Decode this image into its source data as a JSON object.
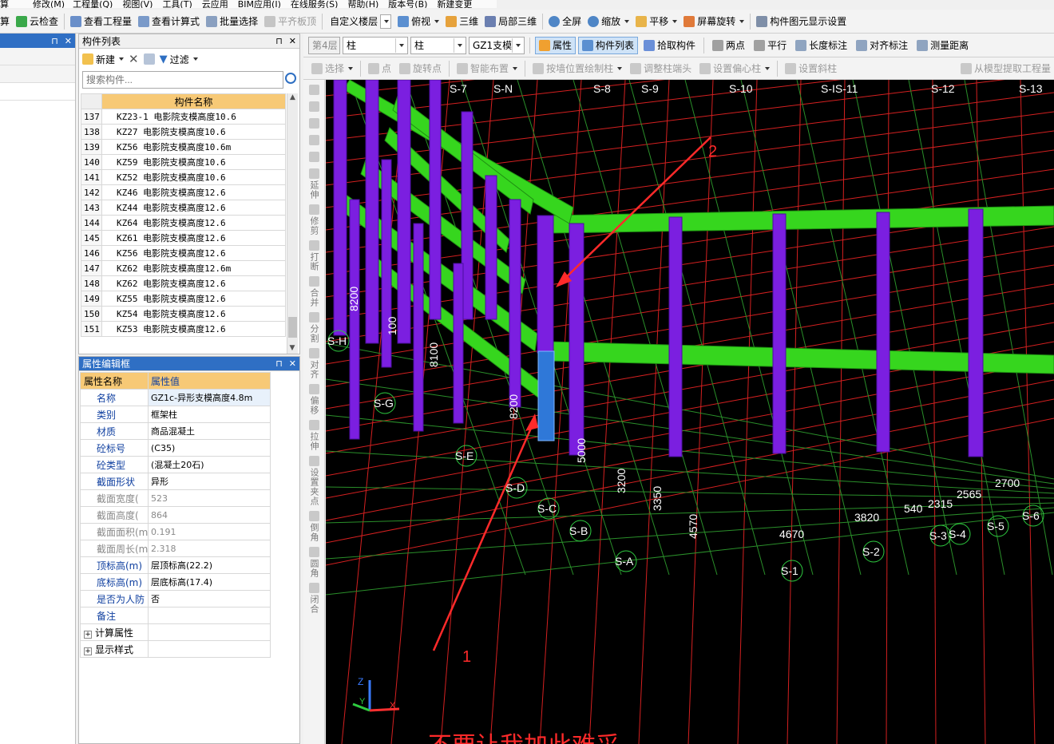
{
  "menu": {
    "items": [
      "算",
      "修改(M)",
      "工程量(Q)",
      "视图(V)",
      "工具(T)",
      "云应用",
      "BIM应用(I)",
      "在线服务(S)",
      "帮助(H)",
      "版本号(B)",
      "新建变更"
    ]
  },
  "toolbar1": {
    "cloud_check": "云检查",
    "view_quantity": "查看工程量",
    "view_formula": "查看计算式",
    "batch_select": "批量选择",
    "align_slab_top": "平齐板顶",
    "custom_floor": "自定义楼层",
    "top_view": "俯视",
    "three_d": "三维",
    "local_3d": "局部三维",
    "full_screen": "全屏",
    "zoom": "缩放",
    "pan": "平移",
    "rotate_screen": "屏幕旋转",
    "element_display_settings": "构件图元显示设置"
  },
  "toolbar2": {
    "floor": "第4层",
    "element_type": "柱",
    "element_subtype": "柱",
    "element_name": "GZ1支模",
    "properties": "属性",
    "element_list": "构件列表",
    "pick_element": "拾取构件",
    "two_points": "两点",
    "parallel": "平行",
    "length_dimension": "长度标注",
    "aligned_dimension": "对齐标注",
    "measure_distance": "测量距离"
  },
  "toolbar3": {
    "select": "选择",
    "point": "点",
    "rotate_point": "旋转点",
    "smart_layout": "智能布置",
    "draw_by_wall": "按墙位置绘制柱",
    "adjust_column_end": "调整柱端头",
    "set_eccentric": "设置偏心柱",
    "set_slanted": "设置斜柱",
    "extract_from_model": "从模型提取工程量"
  },
  "component_list": {
    "title": "构件列表",
    "new_label": "新建",
    "filter_label": "过滤",
    "search_placeholder": "搜索构件...",
    "column_header": "构件名称",
    "rows": [
      {
        "no": "137",
        "name": "KZ23-1  电影院支模高度10.6"
      },
      {
        "no": "138",
        "name": "KZ27 电影院支模高度10.6"
      },
      {
        "no": "139",
        "name": "KZ56 电影院支模高度10.6m"
      },
      {
        "no": "140",
        "name": "KZ59  电影院支模高度10.6"
      },
      {
        "no": "141",
        "name": "KZ52  电影院支模高度10.6"
      },
      {
        "no": "142",
        "name": "KZ46 电影院支模高度12.6"
      },
      {
        "no": "143",
        "name": "KZ44 电影院支模高度12.6"
      },
      {
        "no": "144",
        "name": "KZ64  电影院支模高度12.6"
      },
      {
        "no": "145",
        "name": "KZ61  电影院支模高度12.6"
      },
      {
        "no": "146",
        "name": "KZ56 电影院支模高度12.6"
      },
      {
        "no": "147",
        "name": "KZ62 电影院支模高度12.6m"
      },
      {
        "no": "148",
        "name": "KZ62  电影院支模高度12.6"
      },
      {
        "no": "149",
        "name": "KZ55  电影院支模高度12.6"
      },
      {
        "no": "150",
        "name": "KZ54  电影院支模高度12.6"
      },
      {
        "no": "151",
        "name": "KZ53 电影院支模高度12.6"
      }
    ]
  },
  "property_editor": {
    "title": "属性编辑框",
    "col_name": "属性名称",
    "col_value": "属性值",
    "rows": [
      {
        "name": "名称",
        "value": "GZ1c-异形支模高度4.8m",
        "gray": false
      },
      {
        "name": "类别",
        "value": "框架柱",
        "gray": false
      },
      {
        "name": "材质",
        "value": "商品混凝土",
        "gray": false
      },
      {
        "name": "砼标号",
        "value": "(C35)",
        "gray": false
      },
      {
        "name": "砼类型",
        "value": "(混凝土20石)",
        "gray": false
      },
      {
        "name": "截面形状",
        "value": "异形",
        "gray": false
      },
      {
        "name": "截面宽度(",
        "value": "523",
        "gray": true
      },
      {
        "name": "截面高度(",
        "value": "864",
        "gray": true
      },
      {
        "name": "截面面积(m",
        "value": "0.191",
        "gray": true
      },
      {
        "name": "截面周长(m",
        "value": "2.318",
        "gray": true
      },
      {
        "name": "顶标高(m)",
        "value": "层顶标高(22.2)",
        "gray": false
      },
      {
        "name": "底标高(m)",
        "value": "层底标高(17.4)",
        "gray": false
      },
      {
        "name": "是否为人防",
        "value": "否",
        "gray": false
      },
      {
        "name": "备注",
        "value": "",
        "gray": false
      }
    ],
    "group_calc": "计算属性",
    "group_display": "显示样式"
  },
  "vertical_tools": [
    "延伸",
    "修剪",
    "打断",
    "合并",
    "分割",
    "对齐",
    "偏移",
    "拉伸",
    "设置夹点",
    "倒角",
    "圆角",
    "闭合"
  ],
  "viewport": {
    "axis_labels_top": [
      "S-7",
      "S-N",
      "S-8",
      "S-9",
      "S-10",
      "S-IS-11",
      "S-12",
      "S-13"
    ],
    "axis_labels_left": [
      "S-H",
      "S-G",
      "S-E",
      "S-D",
      "S-C",
      "S-B",
      "S-A",
      "S-1",
      "S-2",
      "S-3",
      "S-4",
      "S-5",
      "S-6"
    ],
    "dims": [
      "8200",
      "100",
      "8100",
      "8200",
      "5000",
      "3200",
      "3350",
      "4570",
      "4670",
      "3820",
      "540",
      "2315",
      "2565",
      "2700"
    ],
    "annotation_1": "1",
    "annotation_2": "2",
    "bottom_text": "不要让我加此难采",
    "axis_z": "Z",
    "axis_y": "Y",
    "axis_x": "X"
  }
}
